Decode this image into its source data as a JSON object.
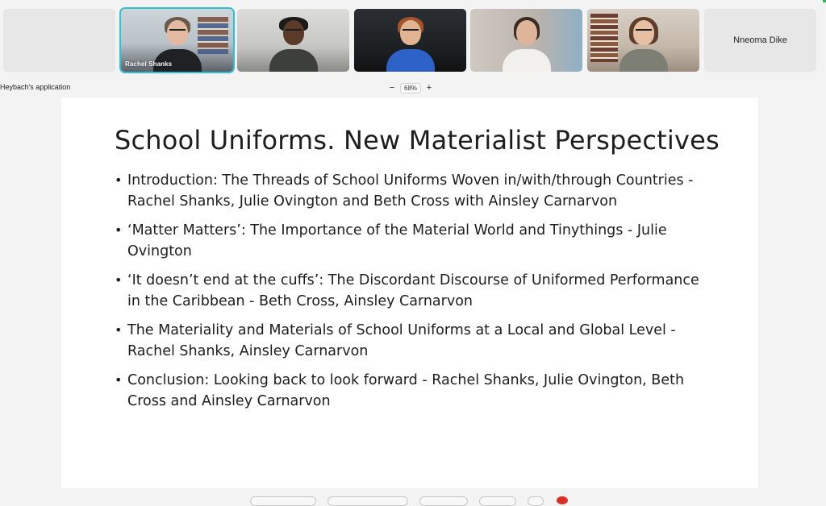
{
  "participants": [
    {
      "name": "",
      "camera": "off"
    },
    {
      "name": "Rachel Shanks",
      "camera": "on",
      "active": true
    },
    {
      "name": "",
      "camera": "on"
    },
    {
      "name": "",
      "camera": "on"
    },
    {
      "name": "",
      "camera": "on"
    },
    {
      "name": "",
      "camera": "on"
    },
    {
      "name": "Nneoma Dike",
      "camera": "off"
    }
  ],
  "share": {
    "label": "Heybach's application",
    "zoom_out": "−",
    "zoom_level": "68%",
    "zoom_in": "+"
  },
  "slide": {
    "title": "School Uniforms. New Materialist Perspectives",
    "bullets": [
      "Introduction: The Threads of School Uniforms Woven in/with/through Countries - Rachel Shanks, Julie Ovington and Beth Cross with Ainsley Carnarvon",
      "‘Matter Matters’: The Importance of the Material World and Tinythings - Julie Ovington",
      "‘It doesn’t end at the cuffs’: The Discordant Discourse of Uniformed Performance in the Caribbean - Beth Cross, Ainsley Carnarvon",
      "The Materiality and Materials of School Uniforms at a Local and Global Level - Rachel Shanks, Ainsley Carnarvon",
      "Conclusion: Looking back to look forward - Rachel Shanks, Julie Ovington, Beth Cross and Ainsley Carnarvon"
    ],
    "bullet_char": "•"
  },
  "colors": {
    "active_speaker_border": "#2ec0d6",
    "leave_button": "#d93025"
  }
}
